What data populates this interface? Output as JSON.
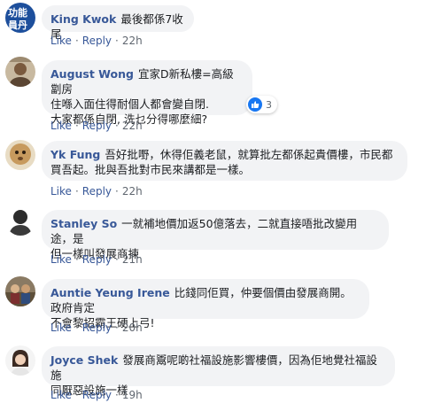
{
  "actions": {
    "like": "Like",
    "reply": "Reply",
    "separator": "·"
  },
  "comments": [
    {
      "author": "King Kwok",
      "text": "最後都係7收尾",
      "time": "22h",
      "avatar_icon": "avatar-king-kwok"
    },
    {
      "author": "August Wong",
      "text": "宜家D新私樓=高級劏房住喺入面住得耐個人都會變自閉.大家都係自閉, 洗乜分得哪麼細?",
      "line1": "宜家D新私樓=高級劏房",
      "line2": "住喺入面住得耐個人都會變自閉.",
      "line3": "大家都係自閉, 洗乜分得哪麼細?",
      "time": "22h",
      "reactions": "3",
      "avatar_icon": "avatar-august-wong"
    },
    {
      "author": "Yk Fung",
      "text": "吾好批嘢，休得佢義老鼠，就算批左都係起貴價樓，市民都買吾起。批與吾批對市民來講都是一樣。",
      "line1": "吾好批嘢，休得佢義老鼠，就算批左都係起貴價樓，市民都",
      "line2": "買吾起。批與吾批對市民來講都是一樣。",
      "time": "22h",
      "avatar_icon": "avatar-yk-fung"
    },
    {
      "author": "Stanley So",
      "text": "一就補地價加返50億落去，二就直接唔批改變用途，是但一樣叫發展商揀",
      "line1": "一就補地價加返50億落去，二就直接唔批改變用途，是",
      "line2": "但一樣叫發展商揀",
      "time": "21h",
      "avatar_icon": "avatar-stanley-so"
    },
    {
      "author": "Auntie Yeung Irene",
      "text": "比錢同佢買，仲要個價由發展商開。政府肯定不會黎招霸王硬上弓!",
      "line1": "比錢同佢買，仲要個價由發展商開。政府肯定",
      "line2": "不會黎招霸王硬上弓!",
      "time": "20h",
      "avatar_icon": "avatar-auntie-yeung-irene"
    },
    {
      "author": "Joyce Shek",
      "text": "發展商鬻呢啲社福設施影響樓價，因為佢地覺社福設施同厭惡設施一樣",
      "line1": "發展商鬻呢啲社福設施影響樓價，因為佢地覺社福設施",
      "line2": "同厭惡設施一樣",
      "time": "19h",
      "avatar_icon": "avatar-joyce-shek"
    }
  ],
  "colors": {
    "author": "#385898",
    "bubble": "#f2f3f5",
    "meta": "#606770",
    "like_badge": "#1877f2"
  }
}
